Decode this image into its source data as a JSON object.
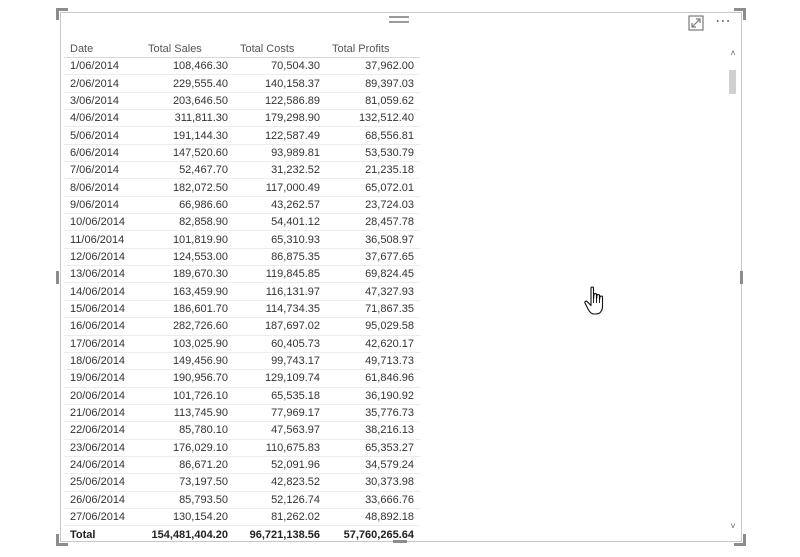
{
  "visual": {
    "icons": {
      "focus_mode": "focus-mode-icon",
      "more_options": "more-options-icon"
    }
  },
  "table": {
    "columns": [
      "Date",
      "Total Sales",
      "Total Costs",
      "Total Profits"
    ],
    "rows": [
      [
        "1/06/2014",
        "108,466.30",
        "70,504.30",
        "37,962.00"
      ],
      [
        "2/06/2014",
        "229,555.40",
        "140,158.37",
        "89,397.03"
      ],
      [
        "3/06/2014",
        "203,646.50",
        "122,586.89",
        "81,059.62"
      ],
      [
        "4/06/2014",
        "311,811.30",
        "179,298.90",
        "132,512.40"
      ],
      [
        "5/06/2014",
        "191,144.30",
        "122,587.49",
        "68,556.81"
      ],
      [
        "6/06/2014",
        "147,520.60",
        "93,989.81",
        "53,530.79"
      ],
      [
        "7/06/2014",
        "52,467.70",
        "31,232.52",
        "21,235.18"
      ],
      [
        "8/06/2014",
        "182,072.50",
        "117,000.49",
        "65,072.01"
      ],
      [
        "9/06/2014",
        "66,986.60",
        "43,262.57",
        "23,724.03"
      ],
      [
        "10/06/2014",
        "82,858.90",
        "54,401.12",
        "28,457.78"
      ],
      [
        "11/06/2014",
        "101,819.90",
        "65,310.93",
        "36,508.97"
      ],
      [
        "12/06/2014",
        "124,553.00",
        "86,875.35",
        "37,677.65"
      ],
      [
        "13/06/2014",
        "189,670.30",
        "119,845.85",
        "69,824.45"
      ],
      [
        "14/06/2014",
        "163,459.90",
        "116,131.97",
        "47,327.93"
      ],
      [
        "15/06/2014",
        "186,601.70",
        "114,734.35",
        "71,867.35"
      ],
      [
        "16/06/2014",
        "282,726.60",
        "187,697.02",
        "95,029.58"
      ],
      [
        "17/06/2014",
        "103,025.90",
        "60,405.73",
        "42,620.17"
      ],
      [
        "18/06/2014",
        "149,456.90",
        "99,743.17",
        "49,713.73"
      ],
      [
        "19/06/2014",
        "190,956.70",
        "129,109.74",
        "61,846.96"
      ],
      [
        "20/06/2014",
        "101,726.10",
        "65,535.18",
        "36,190.92"
      ],
      [
        "21/06/2014",
        "113,745.90",
        "77,969.17",
        "35,776.73"
      ],
      [
        "22/06/2014",
        "85,780.10",
        "47,563.97",
        "38,216.13"
      ],
      [
        "23/06/2014",
        "176,029.10",
        "110,675.83",
        "65,353.27"
      ],
      [
        "24/06/2014",
        "86,671.20",
        "52,091.96",
        "34,579.24"
      ],
      [
        "25/06/2014",
        "73,197.50",
        "42,823.52",
        "30,373.98"
      ],
      [
        "26/06/2014",
        "85,793.50",
        "52,126.74",
        "33,666.76"
      ],
      [
        "27/06/2014",
        "130,154.20",
        "81,262.02",
        "48,892.18"
      ]
    ],
    "total": [
      "Total",
      "154,481,404.20",
      "96,721,138.56",
      "57,760,265.64"
    ]
  },
  "scrollbar": {
    "up_glyph": "˄",
    "down_glyph": "˅"
  }
}
